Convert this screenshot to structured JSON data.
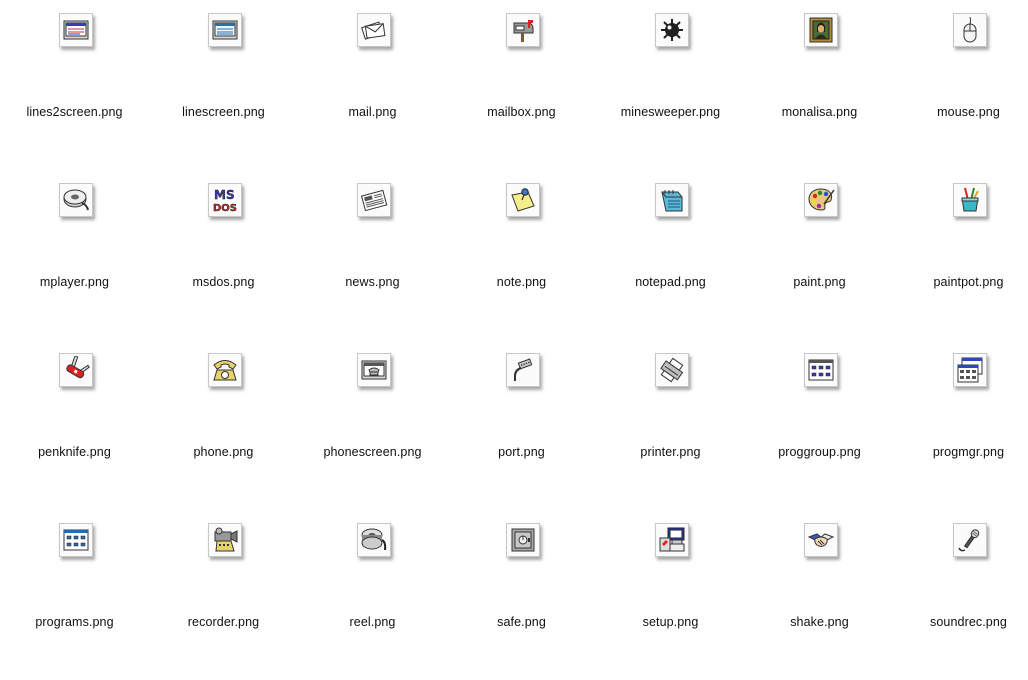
{
  "files": [
    {
      "label": "lines2screen.png",
      "icon": "lines2screen-icon"
    },
    {
      "label": "linescreen.png",
      "icon": "linescreen-icon"
    },
    {
      "label": "mail.png",
      "icon": "mail-icon"
    },
    {
      "label": "mailbox.png",
      "icon": "mailbox-icon"
    },
    {
      "label": "minesweeper.png",
      "icon": "minesweeper-icon"
    },
    {
      "label": "monalisa.png",
      "icon": "monalisa-icon"
    },
    {
      "label": "mouse.png",
      "icon": "mouse-icon"
    },
    {
      "label": "mplayer.png",
      "icon": "mplayer-icon"
    },
    {
      "label": "msdos.png",
      "icon": "msdos-icon"
    },
    {
      "label": "news.png",
      "icon": "news-icon"
    },
    {
      "label": "note.png",
      "icon": "note-icon"
    },
    {
      "label": "notepad.png",
      "icon": "notepad-icon"
    },
    {
      "label": "paint.png",
      "icon": "paint-icon"
    },
    {
      "label": "paintpot.png",
      "icon": "paintpot-icon"
    },
    {
      "label": "penknife.png",
      "icon": "penknife-icon"
    },
    {
      "label": "phone.png",
      "icon": "phone-icon"
    },
    {
      "label": "phonescreen.png",
      "icon": "phonescreen-icon"
    },
    {
      "label": "port.png",
      "icon": "port-icon"
    },
    {
      "label": "printer.png",
      "icon": "printer-icon"
    },
    {
      "label": "proggroup.png",
      "icon": "proggroup-icon"
    },
    {
      "label": "progmgr.png",
      "icon": "progmgr-icon"
    },
    {
      "label": "programs.png",
      "icon": "programs-icon"
    },
    {
      "label": "recorder.png",
      "icon": "recorder-icon"
    },
    {
      "label": "reel.png",
      "icon": "reel-icon"
    },
    {
      "label": "safe.png",
      "icon": "safe-icon"
    },
    {
      "label": "setup.png",
      "icon": "setup-icon"
    },
    {
      "label": "shake.png",
      "icon": "shake-icon"
    },
    {
      "label": "soundrec.png",
      "icon": "soundrec-icon"
    }
  ],
  "icon_glyph_text": {
    "msdos_line1": "MS",
    "msdos_line2": "DOS"
  }
}
